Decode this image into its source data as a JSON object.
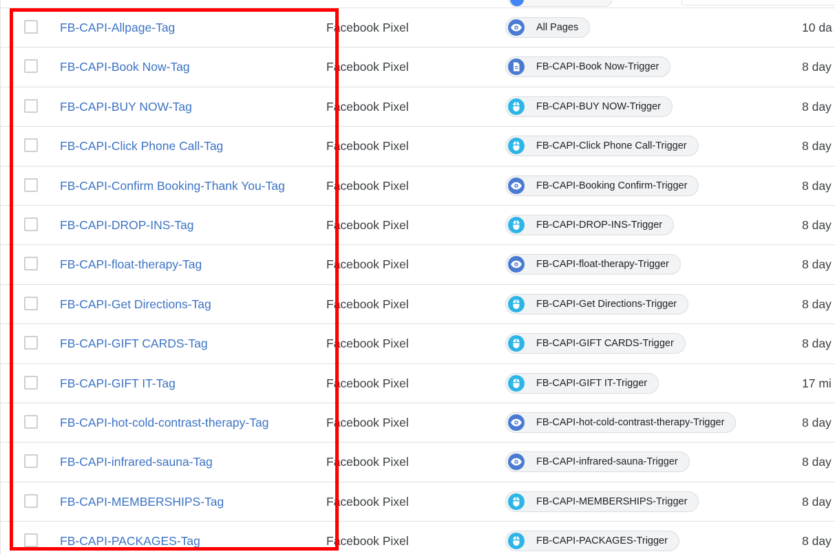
{
  "colors": {
    "highlight": "#ff0000",
    "link": "#3c73c4",
    "page_view_icon": "#4a7bd3",
    "click_icon": "#2db5e8"
  },
  "rows": [
    {
      "name": "FB-CAPI-Allpage-Tag",
      "type": "Facebook Pixel",
      "trigger": "All Pages",
      "trigger_icon": "eye-icon",
      "edited": "10 da"
    },
    {
      "name": "FB-CAPI-Book Now-Tag",
      "type": "Facebook Pixel",
      "trigger": "FB-CAPI-Book Now-Trigger",
      "trigger_icon": "document-icon",
      "edited": "8 day"
    },
    {
      "name": "FB-CAPI-BUY NOW-Tag",
      "type": "Facebook Pixel",
      "trigger": "FB-CAPI-BUY NOW-Trigger",
      "trigger_icon": "mouse-click-icon",
      "edited": "8 day"
    },
    {
      "name": "FB-CAPI-Click Phone Call-Tag",
      "type": "Facebook Pixel",
      "trigger": "FB-CAPI-Click Phone Call-Trigger",
      "trigger_icon": "mouse-click-icon",
      "edited": "8 day"
    },
    {
      "name": "FB-CAPI-Confirm Booking-Thank You-Tag",
      "type": "Facebook Pixel",
      "trigger": "FB-CAPI-Booking Confirm-Trigger",
      "trigger_icon": "eye-icon",
      "edited": "8 day"
    },
    {
      "name": "FB-CAPI-DROP-INS-Tag",
      "type": "Facebook Pixel",
      "trigger": "FB-CAPI-DROP-INS-Trigger",
      "trigger_icon": "mouse-click-icon",
      "edited": "8 day"
    },
    {
      "name": "FB-CAPI-float-therapy-Tag",
      "type": "Facebook Pixel",
      "trigger": "FB-CAPI-float-therapy-Trigger",
      "trigger_icon": "eye-icon",
      "edited": "8 day"
    },
    {
      "name": "FB-CAPI-Get Directions-Tag",
      "type": "Facebook Pixel",
      "trigger": "FB-CAPI-Get Directions-Trigger",
      "trigger_icon": "mouse-click-icon",
      "edited": "8 day"
    },
    {
      "name": "FB-CAPI-GIFT CARDS-Tag",
      "type": "Facebook Pixel",
      "trigger": "FB-CAPI-GIFT CARDS-Trigger",
      "trigger_icon": "mouse-click-icon",
      "edited": "8 day"
    },
    {
      "name": "FB-CAPI-GIFT IT-Tag",
      "type": "Facebook Pixel",
      "trigger": "FB-CAPI-GIFT IT-Trigger",
      "trigger_icon": "mouse-click-icon",
      "edited": "17 mi"
    },
    {
      "name": "FB-CAPI-hot-cold-contrast-therapy-Tag",
      "type": "Facebook Pixel",
      "trigger": "FB-CAPI-hot-cold-contrast-therapy-Trigger",
      "trigger_icon": "eye-icon",
      "edited": "8 day"
    },
    {
      "name": "FB-CAPI-infrared-sauna-Tag",
      "type": "Facebook Pixel",
      "trigger": "FB-CAPI-infrared-sauna-Trigger",
      "trigger_icon": "eye-icon",
      "edited": "8 day"
    },
    {
      "name": "FB-CAPI-MEMBERSHIPS-Tag",
      "type": "Facebook Pixel",
      "trigger": "FB-CAPI-MEMBERSHIPS-Trigger",
      "trigger_icon": "mouse-click-icon",
      "edited": "8 day"
    },
    {
      "name": "FB-CAPI-PACKAGES-Tag",
      "type": "Facebook Pixel",
      "trigger": "FB-CAPI-PACKAGES-Trigger",
      "trigger_icon": "mouse-click-icon",
      "edited": "8 day"
    }
  ]
}
